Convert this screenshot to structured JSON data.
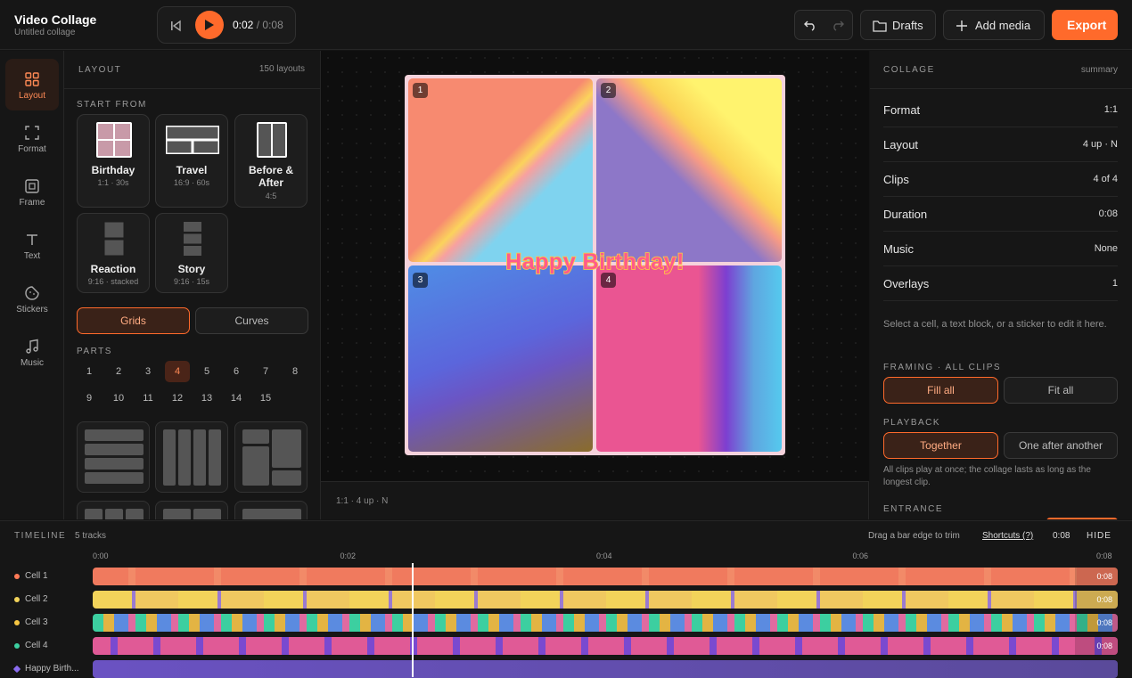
{
  "app": {
    "title": "Video Collage",
    "subtitle": "Untitled collage"
  },
  "player": {
    "current": "0:02",
    "separator": "/",
    "total": "0:08"
  },
  "toolbar": {
    "undo_icon": "undo-icon",
    "redo_icon": "redo-icon",
    "drafts_label": "Drafts",
    "add_media_label": "Add media",
    "export_label": "Export"
  },
  "rail": [
    {
      "label": "Layout",
      "icon": "grid-icon",
      "active": true
    },
    {
      "label": "Format",
      "icon": "crop-icon"
    },
    {
      "label": "Frame",
      "icon": "frame-icon"
    },
    {
      "label": "Text",
      "icon": "text-icon"
    },
    {
      "label": "Stickers",
      "icon": "sticker-icon"
    },
    {
      "label": "Music",
      "icon": "music-icon"
    }
  ],
  "layout_panel": {
    "header": "LAYOUT",
    "count": "150 layouts",
    "start_from": "START FROM",
    "templates": [
      {
        "name": "Birthday",
        "meta": "1:1 · 30s"
      },
      {
        "name": "Travel",
        "meta": "16:9 · 60s"
      },
      {
        "name": "Before & After",
        "meta": "4:5"
      },
      {
        "name": "Reaction",
        "meta": "9:16 · stacked"
      },
      {
        "name": "Story",
        "meta": "9:16 · 15s"
      }
    ],
    "mode_tabs": [
      "Grids",
      "Curves"
    ],
    "active_mode": "Grids",
    "parts_label": "PARTS",
    "parts": [
      "1",
      "2",
      "3",
      "4",
      "5",
      "6",
      "7",
      "8",
      "9",
      "10",
      "11",
      "12",
      "13",
      "14",
      "15"
    ],
    "active_part": "4"
  },
  "canvas": {
    "cells": [
      "1",
      "2",
      "3",
      "4"
    ],
    "overlay_text": "Happy Birthday!",
    "background": "#f5d2dc"
  },
  "stage_footer": "1:1 · 4 up · N",
  "summary_panel": {
    "header": "COLLAGE",
    "tag": "summary",
    "rows": [
      {
        "key": "Format",
        "value": "1:1"
      },
      {
        "key": "Layout",
        "value": "4 up · N"
      },
      {
        "key": "Clips",
        "value": "4 of 4"
      },
      {
        "key": "Duration",
        "value": "0:08"
      },
      {
        "key": "Music",
        "value": "None"
      },
      {
        "key": "Overlays",
        "value": "1"
      }
    ],
    "hint": "Select a cell, a text block, or a sticker to edit it here.",
    "framing_label": "FRAMING · ALL CLIPS",
    "framing_options": [
      "Fill all",
      "Fit all"
    ],
    "framing_selected": "Fill all",
    "playback_label": "PLAYBACK",
    "playback_options": [
      "Together",
      "One after another"
    ],
    "playback_selected": "Together",
    "playback_hint": "All clips play at once; the collage lasts as long as the longest clip.",
    "entrance_label": "ENTRANCE"
  },
  "timeline": {
    "label": "TIMELINE",
    "tracks_count": "5 tracks",
    "hint": "Drag a bar edge to trim",
    "shortcuts": "Shortcuts (?)",
    "time": "0:08",
    "hide": "HIDE",
    "ticks": [
      "0:00",
      "0:02",
      "0:04",
      "0:06",
      "0:08"
    ],
    "playhead_time": "0:02.5",
    "tracks": [
      {
        "label": "Cell 1",
        "end": "0:08",
        "color": "#ff7a57"
      },
      {
        "label": "Cell 2",
        "end": "0:08",
        "color": "#f2d35a"
      },
      {
        "label": "Cell 3",
        "end": "0:08",
        "color": "#f5c542"
      },
      {
        "label": "Cell 4",
        "end": "0:08",
        "color": "#3ccfa0"
      },
      {
        "label": "Happy Birth...",
        "end": "",
        "color": "#8a6cf0"
      }
    ]
  },
  "colors": {
    "accent": "#ff6a2b"
  }
}
